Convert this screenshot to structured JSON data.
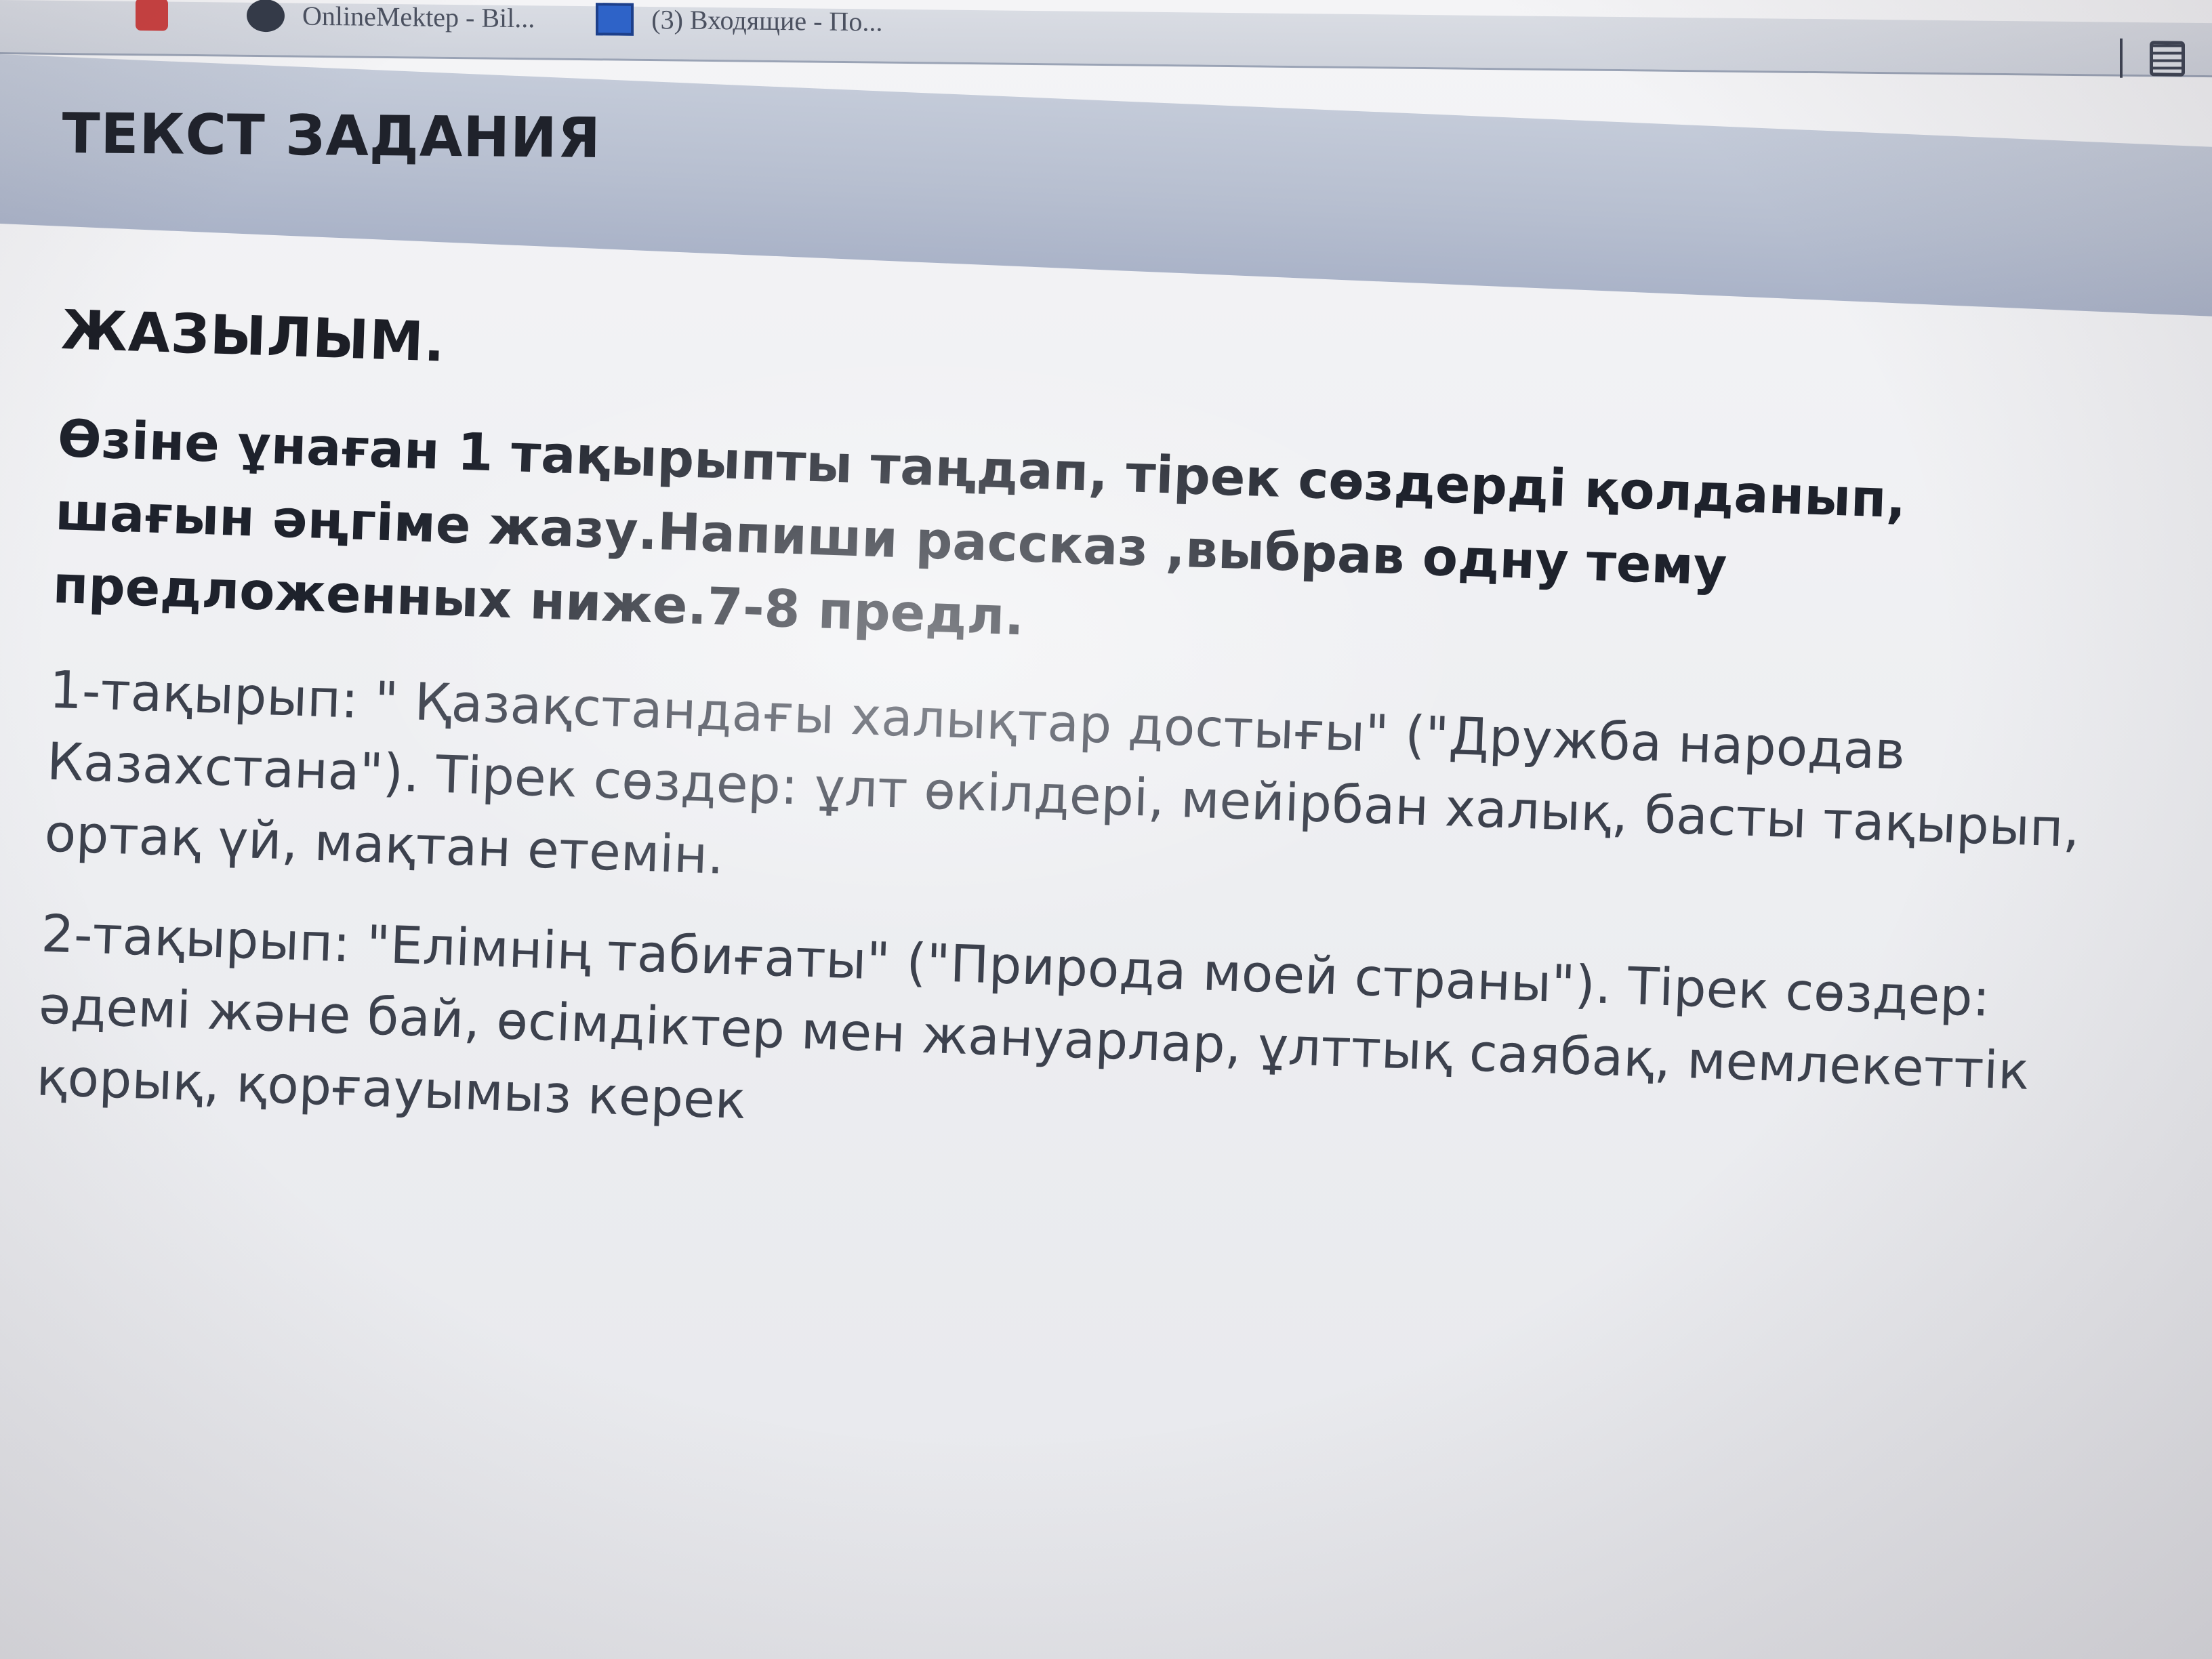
{
  "browser": {
    "bookmarks": [
      {
        "label": "OnlineMektep - Bil...",
        "icon": "onlinemektep-icon"
      },
      {
        "label": "(3) Входящие - По...",
        "icon": "mail-icon"
      }
    ],
    "menu_icon": "reading-list-icon"
  },
  "task": {
    "header_title": "ТЕКСТ ЗАДАНИЯ",
    "section_title": "ЖАЗЫЛЫМ.",
    "instruction": "Өзіне ұнаған 1 тақырыпты таңдап, тірек сөздерді қолданып, шағын әңгіме жазу.Напиши рассказ ,выбрав одну тему предложенных ниже.7-8 предл.",
    "topics": [
      "1-тақырып: \" Қазақстандағы халықтар достығы\" (\"Дружба народав Казахстана\"). Тірек сөздер: ұлт өкілдері, мейірбан халық, басты тақырып, ортақ үй, мақтан етемін.",
      "2-тақырып: \"Елімнің табиғаты\" (\"Природа моей страны\"). Тірек сөздер: әдемі және бай, өсімдіктер мен жануарлар, ұлттық саябақ, мемлекеттік қорық, қорғауымыз керек"
    ]
  },
  "colors": {
    "header_band": "#b7bfd0",
    "page_background": "#eeeff2",
    "heading_text": "#1f222b",
    "body_text": "#3c414d"
  }
}
